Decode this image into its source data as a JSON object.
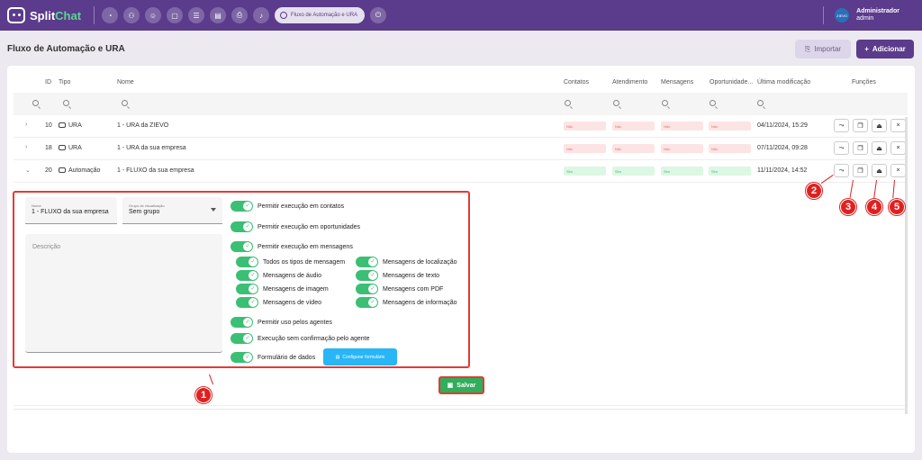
{
  "app": {
    "name_prefix": "Split",
    "name_accent": "Chat"
  },
  "topbar": {
    "nav_icons": [
      "dashboard-icon",
      "contacts-icon",
      "users-icon",
      "chat-icon",
      "list-icon",
      "document-icon",
      "printer-icon",
      "bell-icon"
    ],
    "active_pill": "Fluxo de Automação e URA",
    "user": {
      "avatar_text": "ZIEVO",
      "name": "Administrador",
      "role": "admin"
    }
  },
  "page": {
    "title": "Fluxo de Automação e URA",
    "import_label": "Importar",
    "add_label": "Adicionar"
  },
  "table": {
    "headers": {
      "id": "ID",
      "tipo": "Tipo",
      "nome": "Nome",
      "contatos": "Contatos",
      "atendimento": "Atendimento",
      "mensagens": "Mensagens",
      "oportunidades": "Oportunidade...",
      "modificacao": "Última modificação",
      "funcoes": "Funções"
    },
    "rows": [
      {
        "id": "10",
        "tipo": "URA",
        "nome": "1 - URA da ZIEVO",
        "flags": [
          "Não",
          "Não",
          "Não",
          "Não"
        ],
        "modificacao": "04/11/2024, 15:29",
        "expanded": false
      },
      {
        "id": "18",
        "tipo": "URA",
        "nome": "1 - URA da sua empresa",
        "flags": [
          "Não",
          "Não",
          "Não",
          "Não"
        ],
        "modificacao": "07/11/2024, 09:28",
        "expanded": false
      },
      {
        "id": "20",
        "tipo": "Automação",
        "nome": "1 - FLUXO da sua empresa",
        "flags": [
          "Sim",
          "Sim",
          "Sim",
          "Sim"
        ],
        "modificacao": "11/11/2024, 14:52",
        "expanded": true
      }
    ]
  },
  "form": {
    "nome_label": "Nome",
    "nome_value": "1 - FLUXO da sua empresa",
    "grupo_label": "Grupo de visualização",
    "grupo_value": "Sem grupo",
    "descricao_placeholder": "Descrição",
    "toggles": {
      "contatos": "Permitir execução em contatos",
      "oportunidades": "Permitir execução em oportunidades",
      "mensagens": "Permitir execução em mensagens",
      "todos": "Todos os tipos de mensagem",
      "audio": "Mensagens de áudio",
      "imagem": "Mensagens de imagem",
      "video": "Mensagens de vídeo",
      "localizacao": "Mensagens de localização",
      "texto": "Mensagens de texto",
      "pdf": "Mensagens com PDF",
      "informacao": "Mensagens de informação",
      "agentes": "Permitir uso pelos agentes",
      "sem_confirmacao": "Execução sem confirmação pelo agente",
      "formulario": "Formulário de dados"
    },
    "config_label": "Configurar formulário",
    "save_label": "Salvar"
  },
  "annotations": [
    "1",
    "2",
    "3",
    "4",
    "5"
  ],
  "colors": {
    "primary": "#5b3b8c",
    "success": "#3bbf74",
    "annotation": "#e02020",
    "info": "#29b6f6"
  }
}
